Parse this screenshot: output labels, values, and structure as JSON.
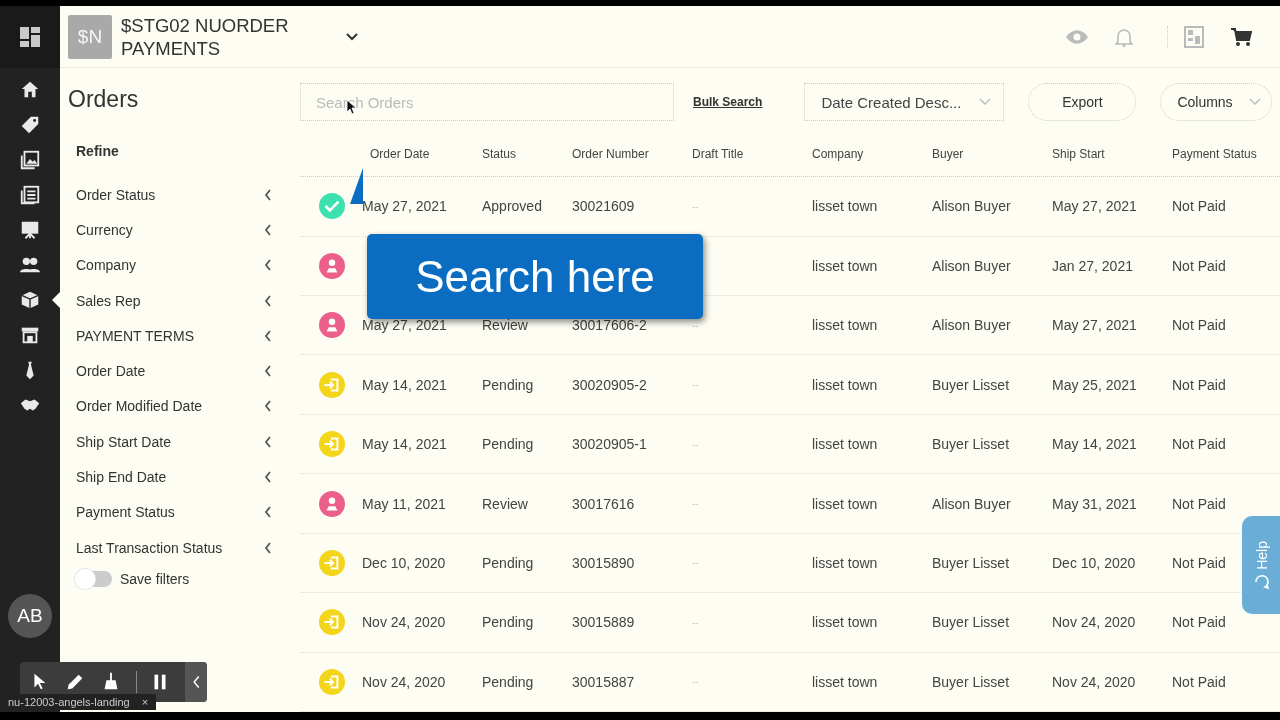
{
  "sidebar": {
    "items": [
      {
        "selected": false
      },
      {
        "selected": false
      },
      {
        "selected": false
      },
      {
        "selected": false
      },
      {
        "selected": false
      },
      {
        "selected": false
      },
      {
        "selected": true
      },
      {
        "selected": false
      },
      {
        "selected": false
      },
      {
        "selected": false
      }
    ],
    "avatar": "AB"
  },
  "header": {
    "logo": "$N",
    "title": "$STG02 NUORDER PAYMENTS"
  },
  "page_title": "Orders",
  "filters": {
    "heading": "Refine",
    "items": [
      "Order Status",
      "Currency",
      "Company",
      "Sales Rep",
      "PAYMENT TERMS",
      "Order Date",
      "Order Modified Date",
      "Ship Start Date",
      "Ship End Date",
      "Payment Status",
      "Last Transaction Status"
    ],
    "save_filters": {
      "label": "Save filters",
      "on": false
    }
  },
  "toolbar": {
    "search_placeholder": "Search Orders",
    "bulk_search": "Bulk Search",
    "sort": "Date Created Desc...",
    "export": "Export",
    "columns": "Columns"
  },
  "table": {
    "columns": [
      "Order Date",
      "Status",
      "Order Number",
      "Draft Title",
      "Company",
      "Buyer",
      "Ship Start",
      "Payment Status"
    ],
    "rows": [
      {
        "kind": "approved",
        "cells": [
          "May 27, 2021",
          "Approved",
          "30021609",
          "--",
          "lisset town",
          "Alison Buyer",
          "May 27, 2021",
          "Not Paid"
        ]
      },
      {
        "kind": "review",
        "cells": [
          "",
          "",
          "",
          "",
          "lisset town",
          "Alison Buyer",
          "Jan 27, 2021",
          "Not Paid"
        ]
      },
      {
        "kind": "review",
        "cells": [
          "May 27, 2021",
          "Review",
          "30017606-2",
          "--",
          "lisset town",
          "Alison Buyer",
          "May 27, 2021",
          "Not Paid"
        ]
      },
      {
        "kind": "pending",
        "cells": [
          "May 14, 2021",
          "Pending",
          "30020905-2",
          "--",
          "lisset town",
          "Buyer Lisset",
          "May 25, 2021",
          "Not Paid"
        ]
      },
      {
        "kind": "pending",
        "cells": [
          "May 14, 2021",
          "Pending",
          "30020905-1",
          "--",
          "lisset town",
          "Buyer Lisset",
          "May 14, 2021",
          "Not Paid"
        ]
      },
      {
        "kind": "review",
        "cells": [
          "May 11, 2021",
          "Review",
          "30017616",
          "--",
          "lisset town",
          "Alison Buyer",
          "May 31, 2021",
          "Not Paid"
        ]
      },
      {
        "kind": "pending",
        "cells": [
          "Dec 10, 2020",
          "Pending",
          "30015890",
          "--",
          "lisset town",
          "Buyer Lisset",
          "Dec 10, 2020",
          "Not Paid"
        ]
      },
      {
        "kind": "pending",
        "cells": [
          "Nov 24, 2020",
          "Pending",
          "30015889",
          "--",
          "lisset town",
          "Buyer Lisset",
          "Nov 24, 2020",
          "Not Paid"
        ]
      },
      {
        "kind": "pending",
        "cells": [
          "Nov 24, 2020",
          "Pending",
          "30015887",
          "--",
          "lisset town",
          "Buyer Lisset",
          "Nov 24, 2020",
          "Not Paid"
        ]
      }
    ]
  },
  "callout": "Search here",
  "help": "Help",
  "recorder": {
    "tag": "nu-12003-angels-landing",
    "tag_close": "×"
  }
}
